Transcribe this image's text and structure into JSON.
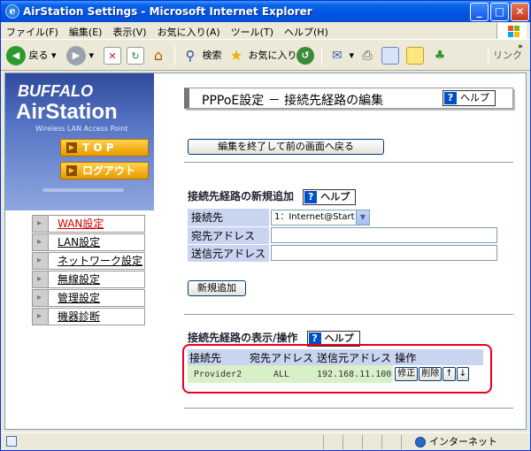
{
  "window": {
    "title": "AirStation Settings - Microsoft Internet Explorer"
  },
  "menu": [
    "ファイル(F)",
    "編集(E)",
    "表示(V)",
    "お気に入り(A)",
    "ツール(T)",
    "ヘルプ(H)"
  ],
  "toolbar": {
    "back": "戻る",
    "search": "検索",
    "favorites": "お気に入り",
    "links": "リンク"
  },
  "sidebar": {
    "brand": "BUFFALO",
    "product": "AirStation",
    "subtitle": "Wireless LAN Access Point",
    "top_btn": "T O P",
    "logout_btn": "ログアウト",
    "items": [
      {
        "label": "WAN設定",
        "active": true
      },
      {
        "label": "LAN設定",
        "active": false
      },
      {
        "label": "ネットワーク設定",
        "active": false
      },
      {
        "label": "無線設定",
        "active": false
      },
      {
        "label": "管理設定",
        "active": false
      },
      {
        "label": "機器診断",
        "active": false
      }
    ]
  },
  "main": {
    "page_title": "PPPoE設定 － 接続先経路の編集",
    "help": "ヘルプ",
    "back_button": "編集を終了して前の画面へ戻る",
    "new_section": {
      "title": "接続先経路の新規追加",
      "connection_label": "接続先",
      "connection_value": "1：Internet@Start",
      "dest_label": "宛先アドレス",
      "src_label": "送信元アドレス",
      "add_button": "新規追加"
    },
    "list_section": {
      "title": "接続先経路の表示/操作",
      "columns": [
        "接続先",
        "宛先アドレス",
        "送信元アドレス",
        "操作"
      ],
      "rows": [
        {
          "connection": "Provider2",
          "dest": "ALL",
          "src": "192.168.11.100",
          "edit": "修正",
          "delete": "削除",
          "up": "↑",
          "down": "↓"
        }
      ]
    }
  },
  "status": {
    "zone": "インターネット"
  },
  "colors": {
    "accent": "#0054e3",
    "table_header": "#c8d4f0",
    "table_row": "#d8f0c8",
    "highlight": "#e8001c"
  }
}
